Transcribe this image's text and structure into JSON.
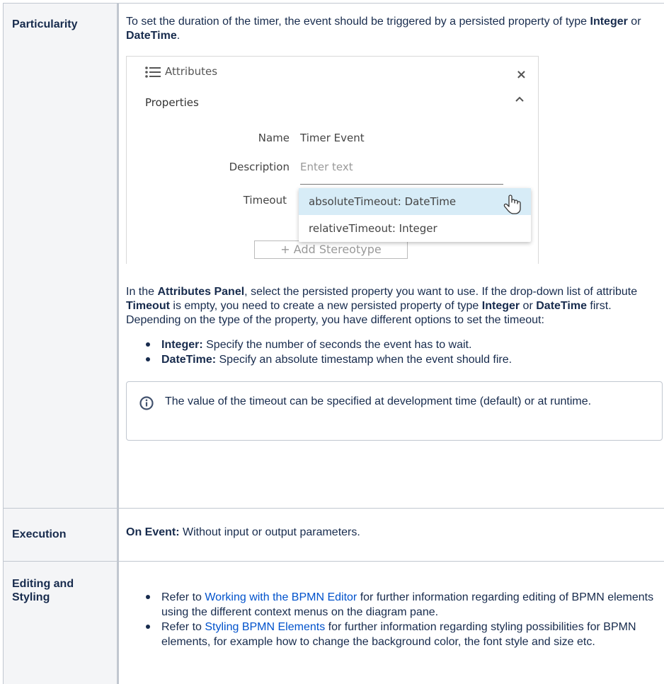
{
  "colors": {
    "link": "#0052cc",
    "header_bg": "#f4f5f7",
    "border": "#c1c7d0",
    "dropdown_selected": "#d7ecf7"
  },
  "rows": [
    {
      "header": "Particularity",
      "intro": {
        "a": "To set the duration of the timer, the event should be triggered by a persisted property of type ",
        "b1": "Integer",
        "c": " or ",
        "b2": "DateTime",
        "d": "."
      },
      "screenshot": {
        "panel_title": "Attributes",
        "panel_icon": "list-icon",
        "close_glyph": "×",
        "section": "Properties",
        "name_label": "Name",
        "name_value": "Timer Event",
        "description_label": "Description",
        "description_placeholder": "Enter text",
        "timeout_label": "Timeout",
        "options": [
          "absoluteTimeout: DateTime",
          "relativeTimeout: Integer"
        ],
        "add_button": "+ Add Stereotype"
      },
      "para": {
        "a": "In the ",
        "b1": "Attributes Panel",
        "c": ", select the persisted property you want to use. If the drop-down list of attribute ",
        "b2": "Timeout",
        "d": " is empty, you need to create a new persisted property of type ",
        "b3": "Integer",
        "e": " or ",
        "b4": "DateTime",
        "f": " first. Depending on the type of the property, you have different options to set the timeout:"
      },
      "bullets": [
        {
          "bold": "Integer:",
          "text": " Specify the number of seconds the event has to wait."
        },
        {
          "bold": "DateTime:",
          "text": " Specify an absolute timestamp when the event should fire."
        }
      ],
      "info": "The value of the timeout can be specified at development time (default) or at runtime."
    },
    {
      "header": "Execution",
      "bold": "On Event:",
      "text": " Without input or output parameters."
    },
    {
      "header": "Editing and Styling",
      "bullets": [
        {
          "pre": "Refer to ",
          "link": "Working with the BPMN Editor",
          "post": " for further information regarding editing of BPMN elements using the different context menus on the diagram pane."
        },
        {
          "pre": "Refer to ",
          "link": "Styling BPMN Elements",
          "post": " for further information regarding styling possibilities for BPMN elements, for example how to change the background color, the font style and size etc."
        }
      ]
    }
  ]
}
